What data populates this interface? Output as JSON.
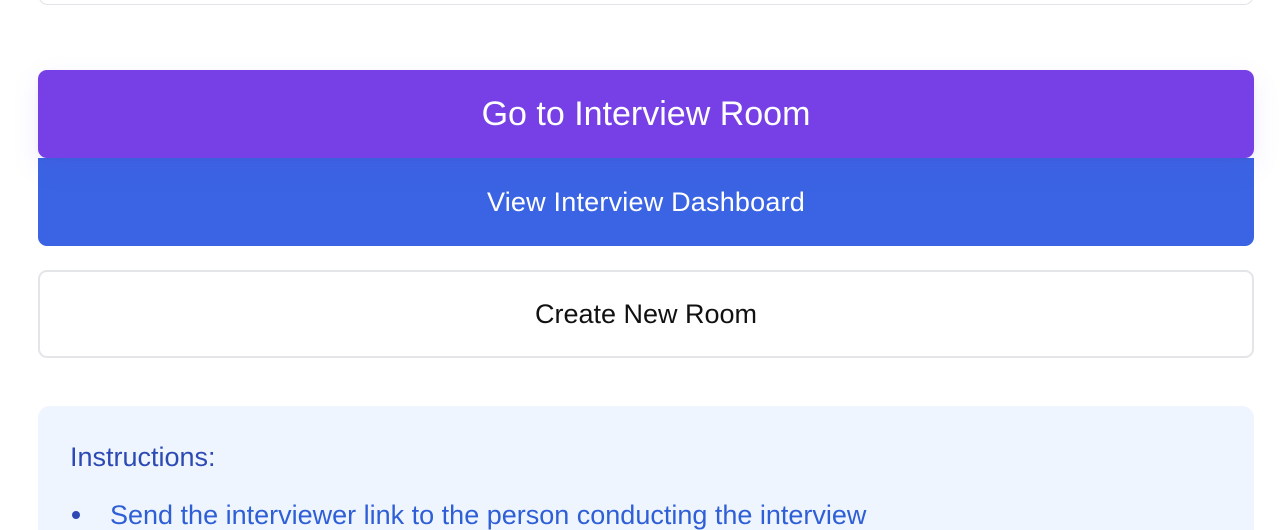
{
  "buttons": {
    "go_to_room": "Go to Interview Room",
    "view_dashboard": "View Interview Dashboard",
    "create_room": "Create New Room"
  },
  "instructions": {
    "title": "Instructions:",
    "items": [
      "Send the interviewer link to the person conducting the interview"
    ]
  },
  "colors": {
    "primary_purple": "#7640e6",
    "secondary_blue": "#3a64e3",
    "instructions_bg": "#eef5fe",
    "instructions_text": "#2c49b4"
  }
}
